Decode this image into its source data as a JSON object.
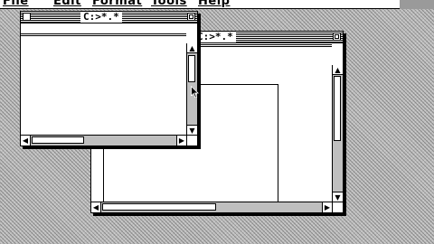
{
  "menu": {
    "items": [
      {
        "label": "File",
        "name": "menu-file"
      },
      {
        "label": "Edit",
        "name": "menu-edit"
      },
      {
        "label": "Format",
        "name": "menu-format"
      },
      {
        "label": "Tools",
        "name": "menu-tools"
      },
      {
        "label": "Help",
        "name": "menu-help"
      }
    ]
  },
  "windows": {
    "front": {
      "title": "C:>*.*"
    },
    "back": {
      "title": "C:>*.*"
    }
  },
  "icons": {
    "scroll_up": "▲",
    "scroll_down": "▼",
    "scroll_left": "◀",
    "scroll_right": "▶",
    "cursor": "arrow-pointer-icon"
  }
}
